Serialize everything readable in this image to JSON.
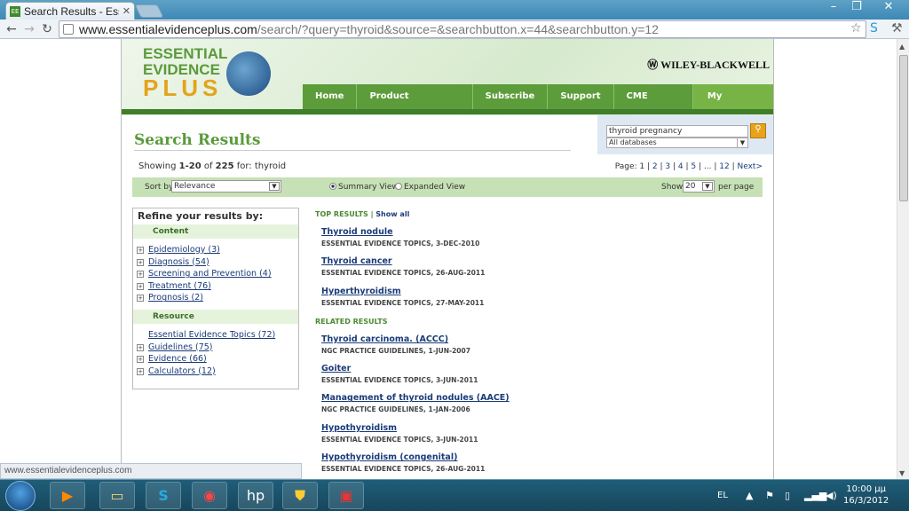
{
  "browser": {
    "tab_title": "Search Results - Essen",
    "tab_favicon": "EE",
    "url_host": "www.essentialevidenceplus.com",
    "url_path": "/search/?query=thyroid&source=&searchbutton.x=44&searchbutton.y=12",
    "status_text": "www.essentialevidenceplus.com"
  },
  "site": {
    "logo_line1": "ESSENTIAL",
    "logo_line2": "EVIDENCE",
    "logo_line3": "PLUS",
    "publisher": "WILEY-BLACKWELL",
    "nav": [
      "Home",
      "Product Information",
      "Subscribe",
      "Support",
      "CME Credits"
    ],
    "account": "My Account"
  },
  "search": {
    "query": "thyroid pregnancy",
    "database": "All databases"
  },
  "results_header": {
    "title": "Search Results",
    "showing_prefix": "Showing ",
    "range": "1-20",
    "of": " of ",
    "total": "225",
    "for_text": " for: thyroid"
  },
  "pager": {
    "label": "Page: 1 |",
    "pages": [
      "2",
      "3",
      "4",
      "5"
    ],
    "ellipsis": "...",
    "last": "12",
    "next": "Next>"
  },
  "sortbar": {
    "sort_label": "Sort by",
    "sort_value": "Relevance",
    "summary_view": "Summary View",
    "expanded_view": "Expanded View",
    "show_label": "Show",
    "show_value": "20",
    "per_page": "per page"
  },
  "refine": {
    "title": "Refine your results by:",
    "content_header": "Content",
    "content_items": [
      "Epidemiology (3)",
      "Diagnosis (54)",
      "Screening and Prevention (4)",
      "Treatment (76)",
      "Prognosis (2)"
    ],
    "resource_header": "Resource",
    "resource_items": [
      "Essential Evidence Topics (72)",
      "Guidelines (75)",
      "Evidence (66)",
      "Calculators (12)"
    ]
  },
  "top_results": {
    "label": "TOP RESULTS |",
    "show_all": "Show all",
    "items": [
      {
        "title": "Thyroid nodule",
        "source": "ESSENTIAL EVIDENCE TOPICS, 3-DEC-2010"
      },
      {
        "title": "Thyroid cancer",
        "source": "ESSENTIAL EVIDENCE TOPICS, 26-AUG-2011"
      },
      {
        "title": "Hyperthyroidism",
        "source": "ESSENTIAL EVIDENCE TOPICS, 27-MAY-2011"
      }
    ]
  },
  "related_results": {
    "label": "RELATED RESULTS",
    "items": [
      {
        "title": "Thyroid carcinoma. (ACCC)",
        "source": "NGC PRACTICE GUIDELINES, 1-JUN-2007"
      },
      {
        "title": "Goiter",
        "source": "ESSENTIAL EVIDENCE TOPICS, 3-JUN-2011"
      },
      {
        "title": "Management of thyroid nodules (AACE)",
        "source": "NGC PRACTICE GUIDELINES, 1-JAN-2006"
      },
      {
        "title": "Hypothyroidism",
        "source": "ESSENTIAL EVIDENCE TOPICS, 3-JUN-2011"
      },
      {
        "title": "Hypothyroidism (congenital)",
        "source": "ESSENTIAL EVIDENCE TOPICS, 26-AUG-2011"
      }
    ]
  },
  "taskbar": {
    "language": "EL",
    "time": "10:00 μμ",
    "date": "16/3/2012"
  },
  "colors": {
    "brand_green": "#5c9c3a",
    "brand_orange": "#e3a41c",
    "link_blue": "#1a3b78"
  }
}
